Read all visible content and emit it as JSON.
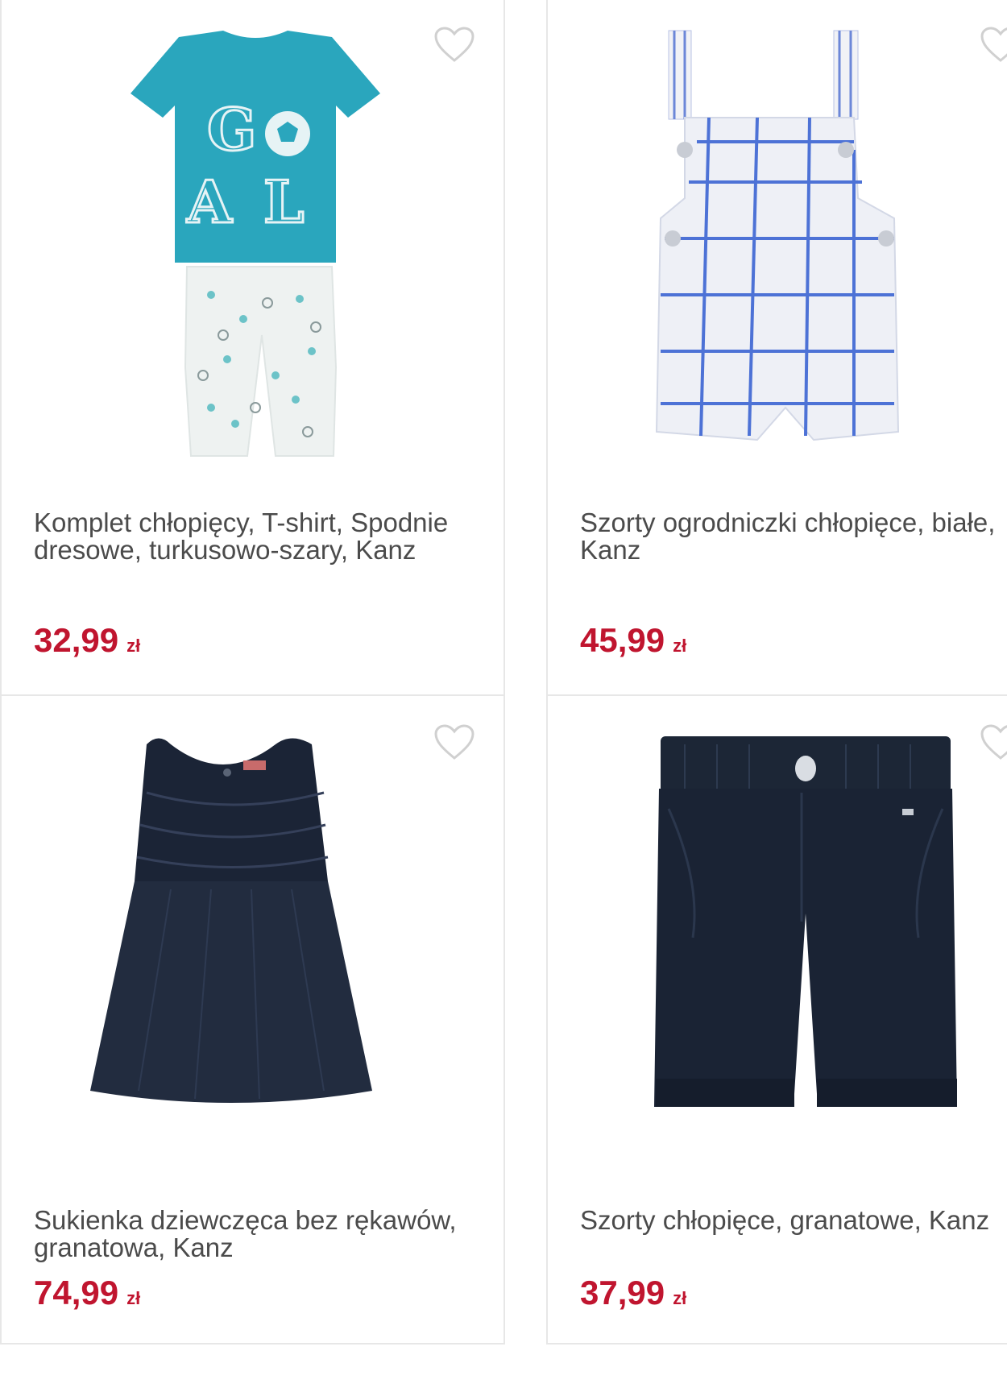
{
  "products": [
    {
      "title": "Komplet chłopięcy, T-shirt, Spodnie dresowe, turkusowo-szary, Kanz",
      "price": "32,99",
      "currency": "zł",
      "image": "tshirt-and-pants-icon",
      "favorite_icon": "heart-outline-icon"
    },
    {
      "title": "Szorty ogrodniczki chłopięce, białe, Kanz",
      "price": "45,99",
      "currency": "zł",
      "image": "dungaree-shorts-icon",
      "favorite_icon": "heart-outline-icon"
    },
    {
      "title": "Sukienka dziewczęca bez rękawów, granatowa, Kanz",
      "price": "74,99",
      "currency": "zł",
      "image": "sleeveless-dress-icon",
      "favorite_icon": "heart-outline-icon"
    },
    {
      "title": "Szorty chłopięce, granatowe, Kanz",
      "price": "37,99",
      "currency": "zł",
      "image": "navy-shorts-icon",
      "favorite_icon": "heart-outline-icon"
    }
  ],
  "colors": {
    "price": "#c0152f",
    "title": "#4b4b4b",
    "card_border": "#e7e7e7",
    "heart": "#d0d0d0"
  }
}
